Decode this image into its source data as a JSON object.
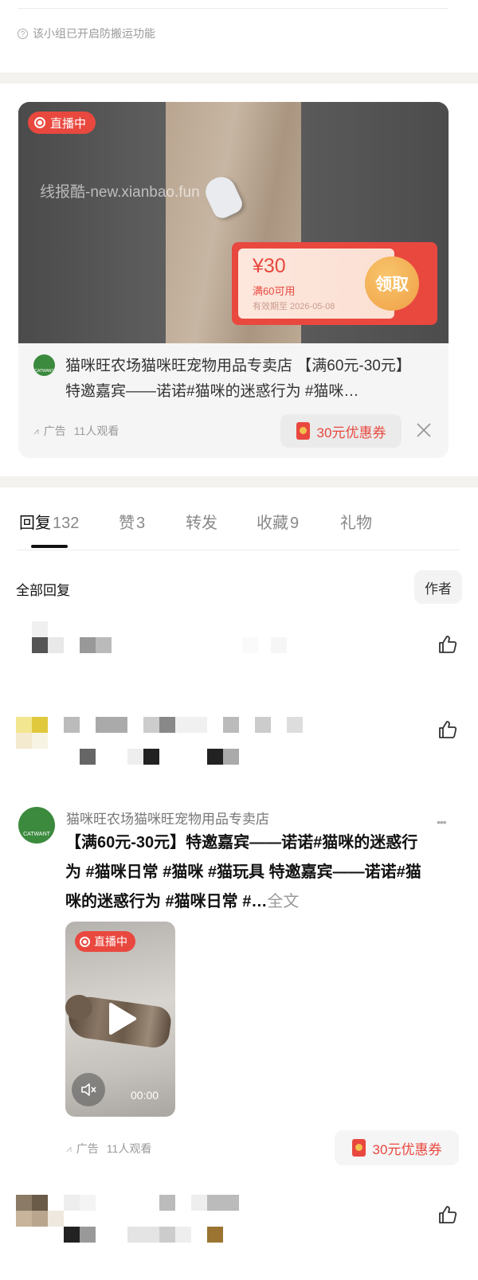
{
  "notice": {
    "text": "该小组已开启防搬运功能"
  },
  "ad_card": {
    "live_badge": "直播中",
    "watermark": "线报酷-new.xianbao.fun",
    "coupon": {
      "amount": "¥30",
      "condition": "满60可用",
      "expiry": "有效期至 2026-05-08",
      "button": "领取"
    },
    "shop_logo_text": "CATWANT",
    "description": "猫咪旺农场猫咪旺宠物用品专卖店 【满60元-30元】特邀嘉宾——诺诺#猫咪的迷惑行为 #猫咪…",
    "ad_label": "广告",
    "views": "11人观看",
    "coupon_pill": "30元优惠券"
  },
  "tabs": [
    {
      "label": "回复",
      "count": "132"
    },
    {
      "label": "赞",
      "count": "3"
    },
    {
      "label": "转发",
      "count": ""
    },
    {
      "label": "收藏",
      "count": "9"
    },
    {
      "label": "礼物",
      "count": ""
    }
  ],
  "replies_header": {
    "title": "全部回复",
    "filter_button": "作者"
  },
  "ad_post": {
    "author": "猫咪旺农场猫咪旺宠物用品专卖店",
    "avatar_text": "CATWANT",
    "body": "【满60元-30元】特邀嘉宾——诺诺#猫咪的迷惑行为 #猫咪日常 #猫咪 #猫玩具 特邀嘉宾——诺诺#猫咪的迷惑行为 #猫咪日常 #…",
    "full_text_link": "全文",
    "video": {
      "live_badge": "直播中",
      "time": "00:00"
    },
    "ad_label": "广告",
    "views": "11人观看",
    "coupon_pill": "30元优惠券",
    "more": "•••"
  },
  "colors": {
    "accent_red": "#e9483f",
    "coupon_orange": "#f2a446",
    "strip": "#f4f2ef"
  }
}
